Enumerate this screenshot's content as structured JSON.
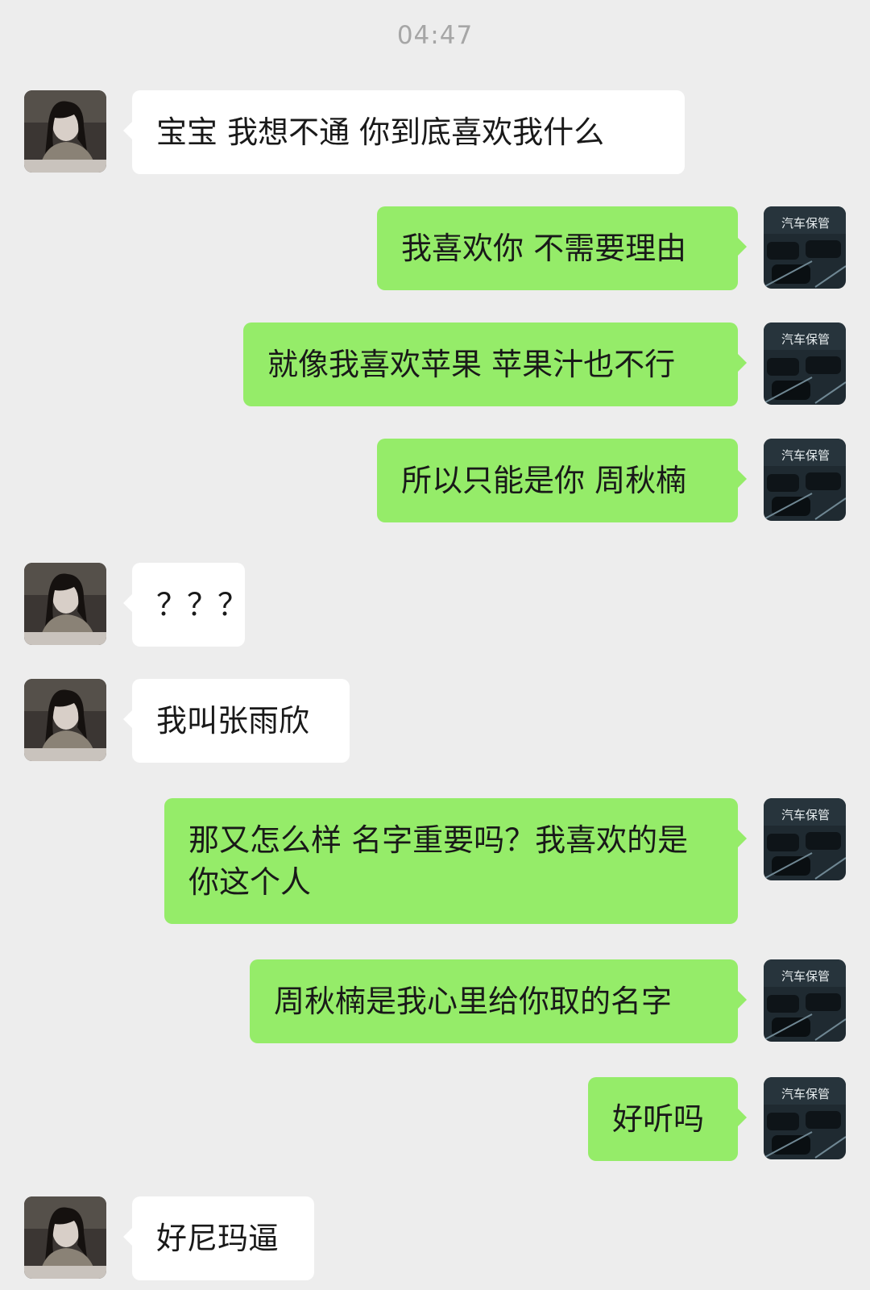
{
  "chat": {
    "timestamp": "04:47",
    "messages": [
      {
        "side": "left",
        "text": "宝宝  我想不通  你到底喜欢我什么",
        "avatar_icon": "girl-avatar-icon"
      },
      {
        "side": "right",
        "text": "我喜欢你 不需要理由",
        "avatar_icon": "car-avatar-icon"
      },
      {
        "side": "right",
        "text": "就像我喜欢苹果 苹果汁也不行",
        "avatar_icon": "car-avatar-icon"
      },
      {
        "side": "right",
        "text": "所以只能是你 周秋楠",
        "avatar_icon": "car-avatar-icon"
      },
      {
        "side": "left",
        "text": "？？？",
        "avatar_icon": "girl-avatar-icon"
      },
      {
        "side": "left",
        "text": "我叫张雨欣",
        "avatar_icon": "girl-avatar-icon"
      },
      {
        "side": "right",
        "text": "那又怎么样 名字重要吗？我喜欢的是你这个人",
        "avatar_icon": "car-avatar-icon"
      },
      {
        "side": "right",
        "text": "周秋楠是我心里给你取的名字",
        "avatar_icon": "car-avatar-icon"
      },
      {
        "side": "right",
        "text": "好听吗",
        "avatar_icon": "car-avatar-icon"
      },
      {
        "side": "left",
        "text": "好尼玛逼",
        "avatar_icon": "girl-avatar-icon"
      }
    ]
  },
  "avatars": {
    "car_avatar_sign": "汽车保管"
  },
  "colors": {
    "background": "#ededed",
    "self_bubble": "#95ec69",
    "other_bubble": "#ffffff",
    "timestamp": "#a6a6a6"
  }
}
